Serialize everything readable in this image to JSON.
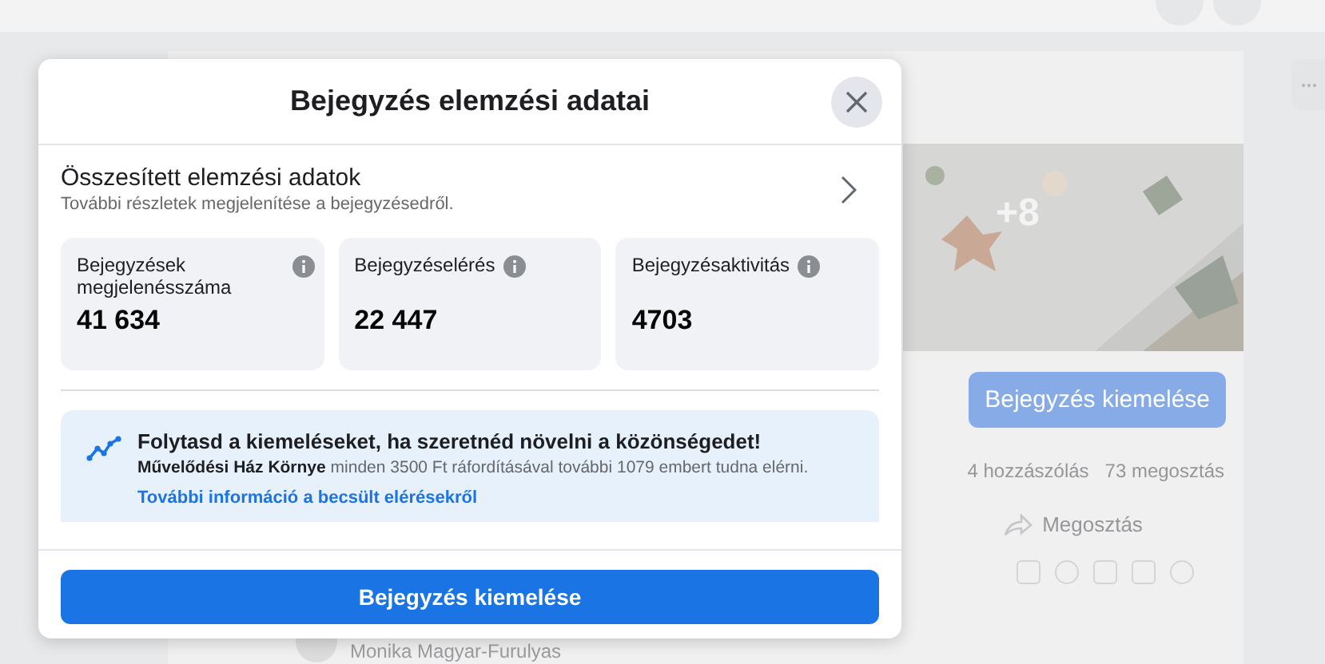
{
  "background": {
    "photo_overlay": "+8",
    "boost_button": "Bejegyzés kiemelése",
    "comments": "4 hozzászólás",
    "shares": "73 megosztás",
    "share_button": "Megosztás",
    "commenter": "Monika Magyar-Furulyas"
  },
  "dialog": {
    "title": "Bejegyzés elemzési adatai",
    "summary": {
      "title": "Összesített elemzési adatok",
      "subtitle": "További részletek megjelenítése a bejegyzésedről."
    },
    "stats": [
      {
        "label": "Bejegyzések megjelenésszáma",
        "value": "41 634"
      },
      {
        "label": "Bejegyzéselérés",
        "value": "22 447"
      },
      {
        "label": "Bejegyzésaktivitás",
        "value": "4703"
      }
    ],
    "promo": {
      "title": "Folytasd a kiemeléseket, ha szeretnéd növelni a közönségedet!",
      "text": "**Művelődési Ház Környe** minden 3500 Ft ráfordításával további 1079 embert tudna elérni.",
      "link": "További információ a becsült elérésekről"
    },
    "button": "Bejegyzés kiemelése"
  }
}
